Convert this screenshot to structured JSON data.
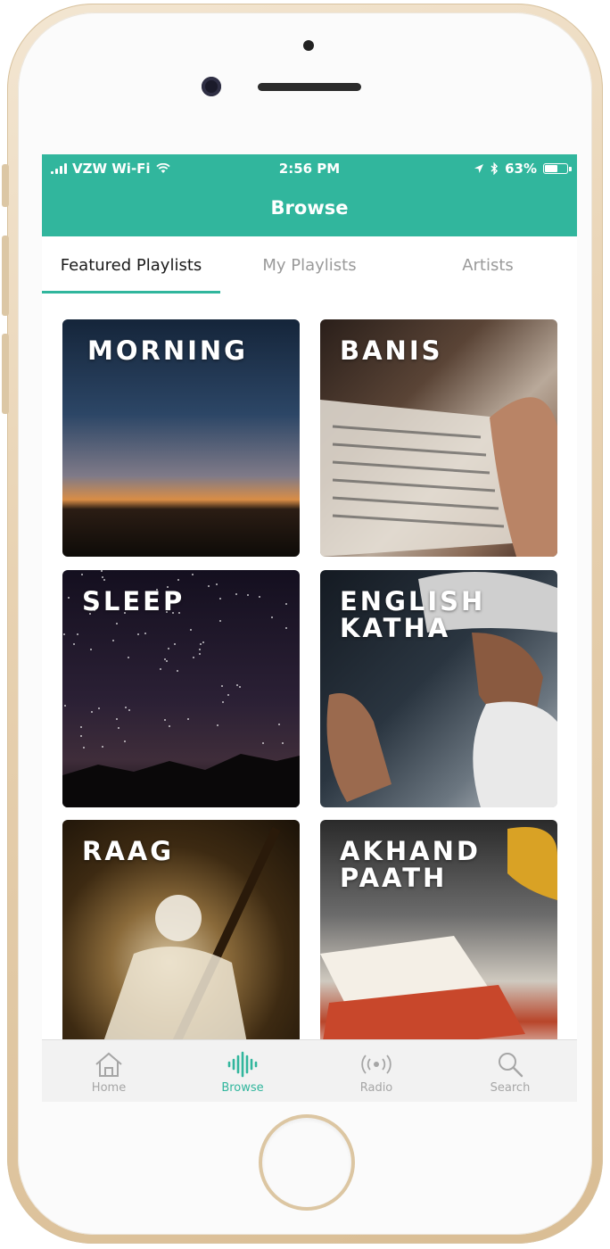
{
  "status_bar": {
    "carrier": "VZW Wi-Fi",
    "time": "2:56 PM",
    "battery_percent": "63%",
    "battery_level": 0.63,
    "icons": [
      "signal-icon",
      "wifi-icon",
      "location-icon",
      "bluetooth-icon",
      "battery-icon"
    ]
  },
  "header": {
    "title": "Browse"
  },
  "tabs": [
    {
      "label": "Featured Playlists",
      "active": true
    },
    {
      "label": "My Playlists",
      "active": false
    },
    {
      "label": "Artists",
      "active": false
    }
  ],
  "playlists": [
    {
      "title_lines": [
        "MORNING"
      ]
    },
    {
      "title_lines": [
        "BANIS"
      ]
    },
    {
      "title_lines": [
        "SLEEP"
      ]
    },
    {
      "title_lines": [
        "ENGLISH",
        "KATHA"
      ]
    },
    {
      "title_lines": [
        "RAAG"
      ]
    },
    {
      "title_lines": [
        "AKHAND",
        "PAATH"
      ]
    }
  ],
  "tab_bar": {
    "items": [
      {
        "label": "Home",
        "icon": "home-icon",
        "active": false
      },
      {
        "label": "Browse",
        "icon": "waveform-icon",
        "active": true
      },
      {
        "label": "Radio",
        "icon": "radio-icon",
        "active": false
      },
      {
        "label": "Search",
        "icon": "search-icon",
        "active": false
      }
    ]
  },
  "colors": {
    "accent": "#31b69d",
    "inactive_text": "#9a9a9a",
    "phone_frame": "#e8d2b2"
  }
}
